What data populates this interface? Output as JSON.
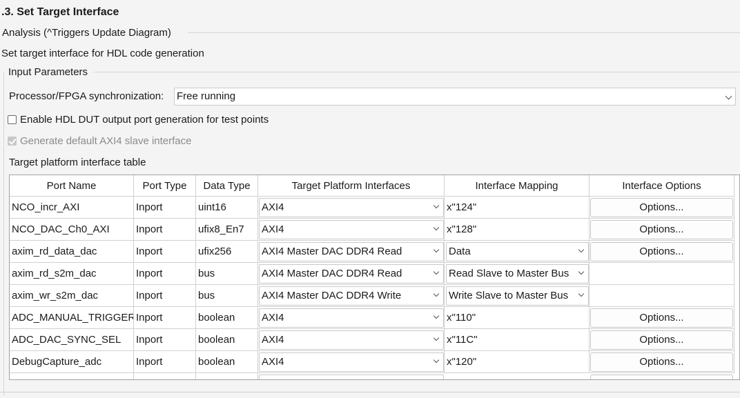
{
  "section_title": ".3. Set Target Interface",
  "analysis_label": "Analysis (^Triggers Update Diagram)",
  "description": "Set target interface for HDL code generation",
  "input_parameters": {
    "group_label": "Input Parameters",
    "sync_label": "Processor/FPGA synchronization:",
    "sync_value": "Free running",
    "enable_dut_label": "Enable HDL DUT output port generation for test points",
    "axi4_slave_label": "Generate default AXI4 slave interface",
    "table_label": "Target platform interface table"
  },
  "table": {
    "columns": [
      "Port Name",
      "Port Type",
      "Data Type",
      "Target Platform Interfaces",
      "Interface Mapping",
      "Interface Options"
    ],
    "rows": [
      {
        "port": "NCO_incr_AXI",
        "type": "Inport",
        "dtype": "uint16",
        "iface": "AXI4",
        "mapping": "x\"124\"",
        "options": "Options..."
      },
      {
        "port": "NCO_DAC_Ch0_AXI",
        "type": "Inport",
        "dtype": "ufix8_En7",
        "iface": "AXI4",
        "mapping": "x\"128\"",
        "options": "Options..."
      },
      {
        "port": "axim_rd_data_dac",
        "type": "Inport",
        "dtype": "ufix256",
        "iface": "AXI4 Master DAC DDR4 Read",
        "mapping": "Data",
        "options": "Options..."
      },
      {
        "port": "axim_rd_s2m_dac",
        "type": "Inport",
        "dtype": "bus",
        "iface": "AXI4 Master DAC DDR4 Read",
        "mapping": "Read Slave to Master Bus",
        "options": ""
      },
      {
        "port": "axim_wr_s2m_dac",
        "type": "Inport",
        "dtype": "bus",
        "iface": "AXI4 Master DAC DDR4 Write",
        "mapping": "Write Slave to Master Bus",
        "options": ""
      },
      {
        "port": "ADC_MANUAL_TRIGGER",
        "type": "Inport",
        "dtype": "boolean",
        "iface": "AXI4",
        "mapping": "x\"110\"",
        "options": "Options..."
      },
      {
        "port": "ADC_DAC_SYNC_SEL",
        "type": "Inport",
        "dtype": "boolean",
        "iface": "AXI4",
        "mapping": "x\"11C\"",
        "options": "Options..."
      },
      {
        "port": "DebugCapture_adc",
        "type": "Inport",
        "dtype": "boolean",
        "iface": "AXI4",
        "mapping": "x\"120\"",
        "options": "Options..."
      }
    ]
  }
}
